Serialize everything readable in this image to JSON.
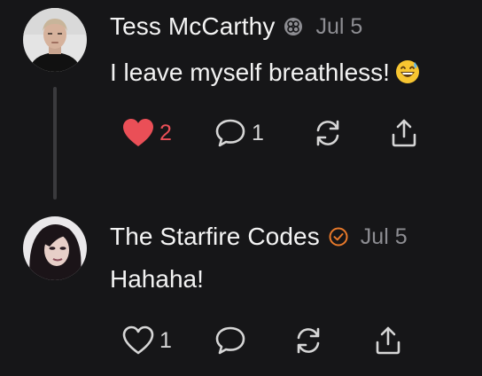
{
  "posts": [
    {
      "author": "Tess McCarthy",
      "badge_icon": "community-badge-icon",
      "date": "Jul 5",
      "text": "I leave myself breathless!",
      "emoji": "grinning-sweat-emoji",
      "likes": "2",
      "liked": true,
      "comments": "1"
    },
    {
      "author": "The Starfire Codes",
      "badge_icon": "verified-check-icon",
      "date": "Jul 5",
      "text": "Hahaha!",
      "likes": "1",
      "liked": false,
      "comments": ""
    }
  ],
  "colors": {
    "background": "#161618",
    "like_red": "#ea4f57",
    "verified_orange": "#e8792a",
    "muted": "#8d8d92"
  }
}
